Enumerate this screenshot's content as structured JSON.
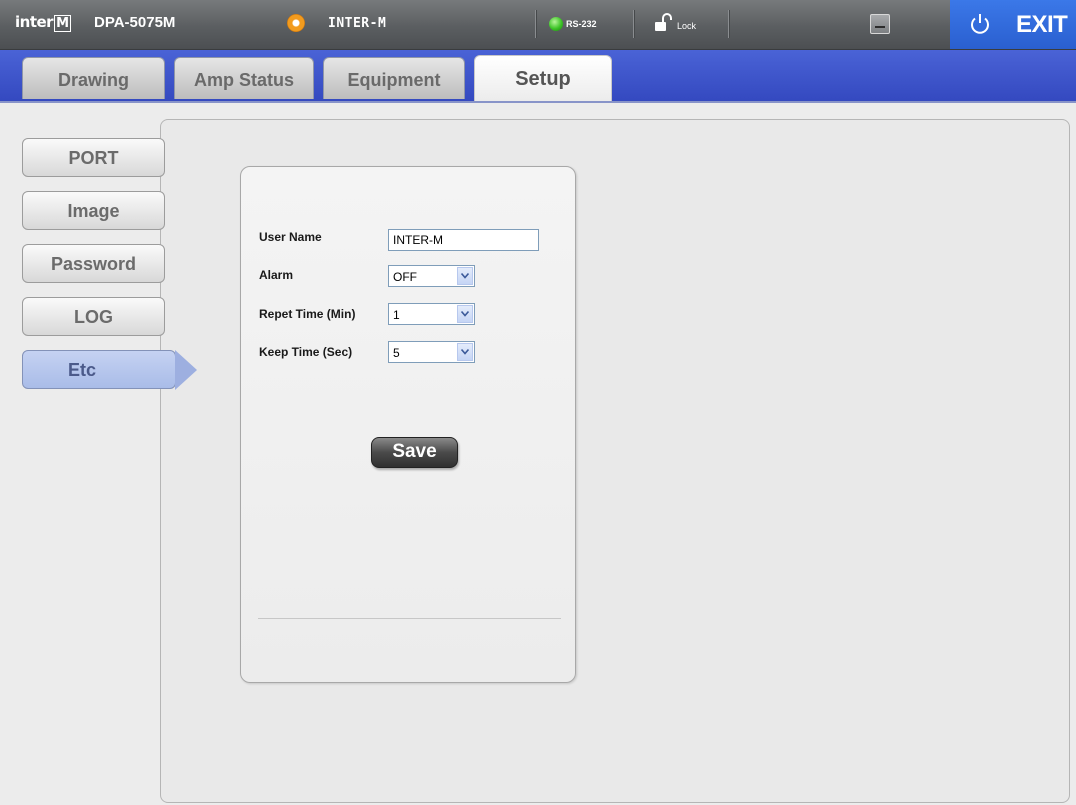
{
  "app": {
    "brand": "inter",
    "brand_mark": "M",
    "model": "DPA-5075M",
    "user": "INTER-M",
    "port_status": "RS-232",
    "lock_label": "Lock",
    "exit_label": "EXIT"
  },
  "tabs": [
    {
      "label": "Drawing"
    },
    {
      "label": "Amp Status"
    },
    {
      "label": "Equipment"
    },
    {
      "label": "Setup"
    }
  ],
  "sidebar": {
    "items": [
      {
        "label": "PORT"
      },
      {
        "label": "Image"
      },
      {
        "label": "Password"
      },
      {
        "label": "LOG"
      },
      {
        "label": "Etc"
      }
    ]
  },
  "form": {
    "user_name_label": "User Name",
    "user_name_value": "INTER-M",
    "alarm_label": "Alarm",
    "alarm_value": "OFF",
    "repeat_label": "Repet Time (Min)",
    "repeat_value": "1",
    "keep_label": "Keep Time (Sec)",
    "keep_value": "5",
    "save_label": "Save"
  },
  "colors": {
    "accent_blue": "#3449c0",
    "exit_blue": "#2a5fd0",
    "active_nav": "#a9bce8",
    "status_green": "#3cc426",
    "user_orange": "#f29b1e"
  },
  "icons": {
    "user": "orange-circle-icon",
    "status": "green-led-icon",
    "lock": "unlock-icon",
    "minimize": "minimize-icon",
    "power": "power-icon"
  }
}
